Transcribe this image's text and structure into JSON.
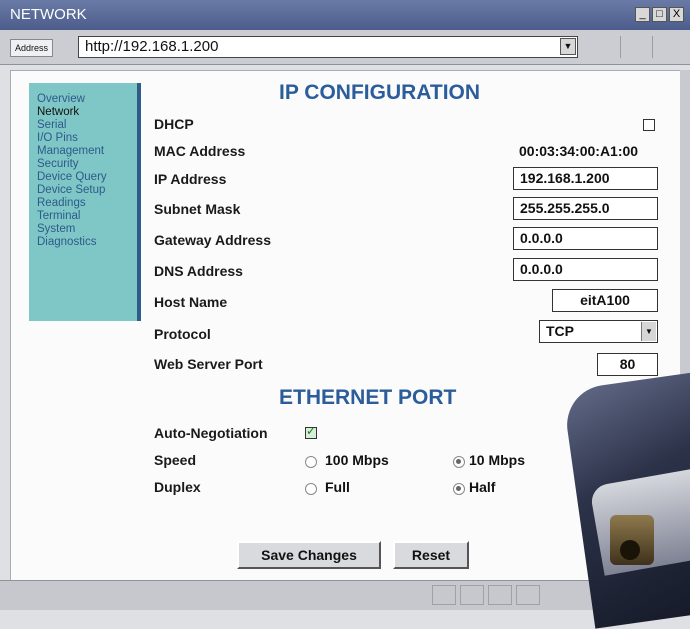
{
  "window": {
    "title": "NETWORK",
    "controls": {
      "minimize": "_",
      "maximize": "□",
      "close": "X"
    }
  },
  "address_bar": {
    "label": "Address",
    "url": "http://192.168.1.200"
  },
  "sidebar": {
    "items": [
      {
        "label": "Overview",
        "active": false
      },
      {
        "label": "Network",
        "active": true
      },
      {
        "label": "Serial",
        "active": false
      },
      {
        "label": "I/O Pins",
        "active": false
      },
      {
        "label": "Management",
        "active": false
      },
      {
        "label": "Security",
        "active": false
      },
      {
        "label": "Device Query",
        "active": false
      },
      {
        "label": "Device Setup",
        "active": false
      },
      {
        "label": "Readings",
        "active": false
      },
      {
        "label": "Terminal",
        "active": false
      },
      {
        "label": "System",
        "active": false
      },
      {
        "label": "Diagnostics",
        "active": false
      }
    ]
  },
  "ip_config": {
    "title": "IP CONFIGURATION",
    "dhcp": {
      "label": "DHCP",
      "checked": false
    },
    "mac": {
      "label": "MAC Address",
      "value": "00:03:34:00:A1:00"
    },
    "ip": {
      "label": "IP Address",
      "value": "192.168.1.200"
    },
    "subnet": {
      "label": "Subnet Mask",
      "value": "255.255.255.0"
    },
    "gateway": {
      "label": "Gateway Address",
      "value": "0.0.0.0"
    },
    "dns": {
      "label": "DNS Address",
      "value": "0.0.0.0"
    },
    "host": {
      "label": "Host Name",
      "value": "eitA100"
    },
    "protocol": {
      "label": "Protocol",
      "value": "TCP"
    },
    "port": {
      "label": "Web Server Port",
      "value": "80"
    }
  },
  "ethernet": {
    "title": "ETHERNET PORT",
    "auto_negotiation": {
      "label": "Auto-Negotiation",
      "checked": true
    },
    "speed": {
      "label": "Speed",
      "opt1": "100 Mbps",
      "opt2": "10 Mbps",
      "selected": "10 Mbps"
    },
    "duplex": {
      "label": "Duplex",
      "opt1": "Full",
      "opt2": "Half",
      "selected": "Half"
    }
  },
  "buttons": {
    "save": "Save Changes",
    "reset": "Reset"
  },
  "colors": {
    "title_blue": "#2c5d9b",
    "sidebar_bg": "#7fc7c6",
    "sidebar_link": "#2d5a8a"
  }
}
